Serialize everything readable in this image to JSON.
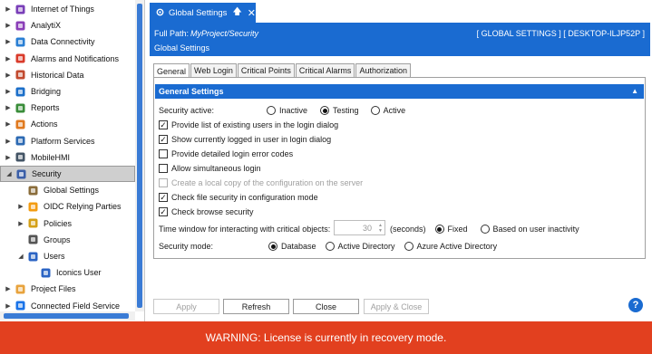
{
  "tree": {
    "items": [
      {
        "label": "Internet of Things",
        "icon": "iot-icon",
        "expander": "▶"
      },
      {
        "label": "AnalytiX",
        "icon": "analytix-icon",
        "expander": "▶"
      },
      {
        "label": "Data Connectivity",
        "icon": "data-connectivity-icon",
        "expander": "▶"
      },
      {
        "label": "Alarms and Notifications",
        "icon": "alarm-icon",
        "expander": "▶"
      },
      {
        "label": "Historical Data",
        "icon": "historical-data-icon",
        "expander": "▶"
      },
      {
        "label": "Bridging",
        "icon": "bridging-icon",
        "expander": "▶"
      },
      {
        "label": "Reports",
        "icon": "reports-icon",
        "expander": "▶"
      },
      {
        "label": "Actions",
        "icon": "actions-icon",
        "expander": "▶"
      },
      {
        "label": "Platform Services",
        "icon": "platform-services-icon",
        "expander": "▶"
      },
      {
        "label": "MobileHMI",
        "icon": "mobile-hmi-icon",
        "expander": "▶"
      },
      {
        "label": "Security",
        "icon": "security-shield-icon",
        "expander": "◢"
      },
      {
        "label": "Global Settings",
        "icon": "global-settings-icon",
        "expander": ""
      },
      {
        "label": "OIDC Relying Parties",
        "icon": "oidc-icon",
        "expander": "▶"
      },
      {
        "label": "Policies",
        "icon": "policies-icon",
        "expander": "▶"
      },
      {
        "label": "Groups",
        "icon": "groups-icon",
        "expander": ""
      },
      {
        "label": "Users",
        "icon": "users-icon",
        "expander": "◢"
      },
      {
        "label": "Iconics User",
        "icon": "user-icon",
        "expander": ""
      },
      {
        "label": "Project Files",
        "icon": "project-files-icon",
        "expander": "▶"
      },
      {
        "label": "Connected Field Service",
        "icon": "connected-field-service-icon",
        "expander": "▶"
      }
    ]
  },
  "doc_tab": {
    "label": "Global Settings",
    "pin": "🡅",
    "close": "✕"
  },
  "header": {
    "path_label": "Full Path:",
    "path_value": "MyProject/Security",
    "server": "[ GLOBAL SETTINGS ] [ DESKTOP-ILJP52P ]",
    "crumb": "Global Settings"
  },
  "tabs": [
    {
      "label": "General"
    },
    {
      "label": "Web Login"
    },
    {
      "label": "Critical Points"
    },
    {
      "label": "Critical Alarms"
    },
    {
      "label": "Authorization"
    }
  ],
  "section": {
    "title": "General Settings",
    "collapse": "▲"
  },
  "security_active": {
    "label": "Security active:",
    "options": [
      "Inactive",
      "Testing",
      "Active"
    ],
    "selected": "Testing"
  },
  "checkboxes": [
    {
      "label": "Provide list of existing users in the login dialog",
      "checked": true
    },
    {
      "label": "Show currently logged in user in login dialog",
      "checked": true
    },
    {
      "label": "Provide detailed login error codes",
      "checked": false
    },
    {
      "label": "Allow simultaneous login",
      "checked": false
    },
    {
      "label": "Create a local copy of the configuration on the server",
      "checked": false,
      "disabled": true
    },
    {
      "label": "Check file security in configuration mode",
      "checked": true
    },
    {
      "label": "Check browse security",
      "checked": true
    }
  ],
  "time_window": {
    "label": "Time window for interacting with critical objects:",
    "value": "30",
    "unit": "(seconds)",
    "options": [
      "Fixed",
      "Based on user inactivity"
    ],
    "selected": "Fixed"
  },
  "security_mode": {
    "label": "Security mode:",
    "options": [
      "Database",
      "Active Directory",
      "Azure Active Directory"
    ],
    "selected": "Database"
  },
  "buttons": {
    "apply": "Apply",
    "refresh": "Refresh",
    "close": "Close",
    "apply_close": "Apply & Close",
    "help": "?"
  },
  "warning": "WARNING: License is currently in recovery mode.",
  "colors": {
    "accent": "#1a6bd1",
    "warning": "#e2401f"
  }
}
